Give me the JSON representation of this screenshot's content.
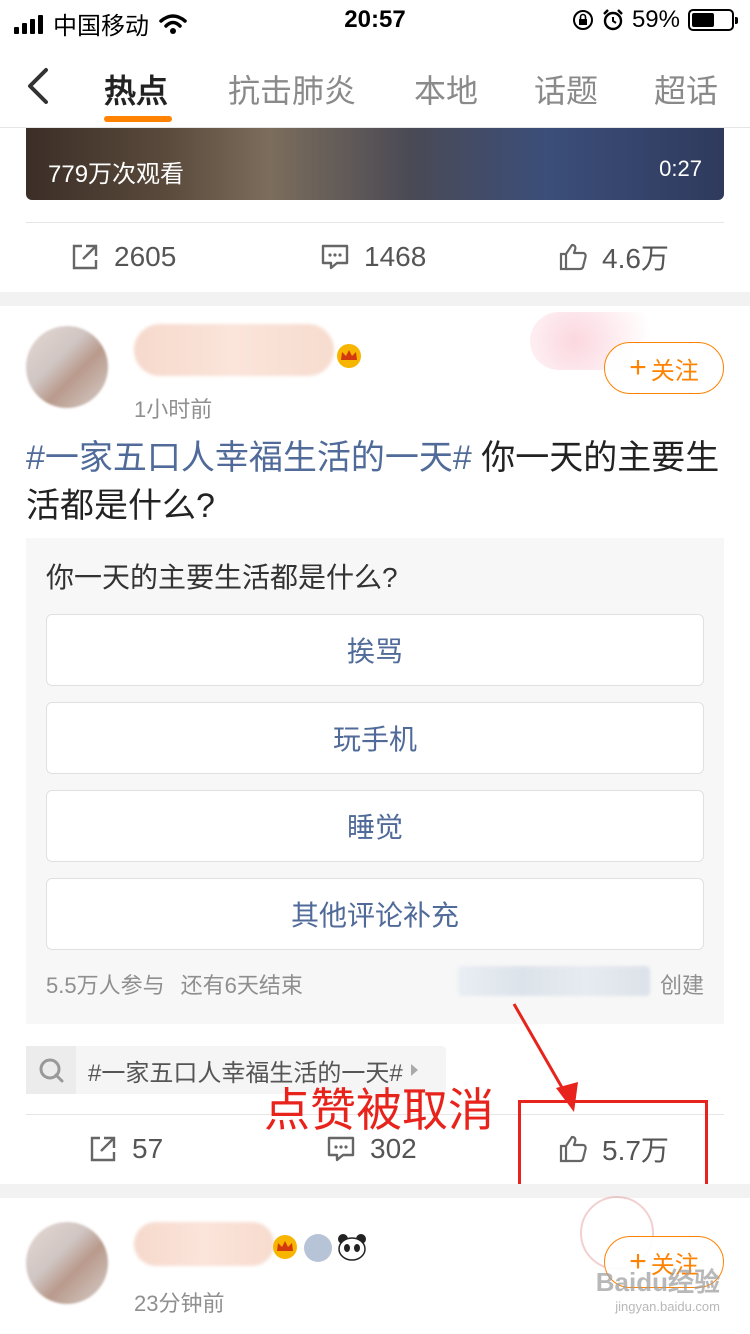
{
  "status_bar": {
    "carrier": "中国移动",
    "time": "20:57",
    "battery": "59%",
    "battery_level": 0.59
  },
  "nav": {
    "tabs": [
      "热点",
      "抗击肺炎",
      "本地",
      "话题",
      "超话"
    ],
    "active_index": 0
  },
  "video_post": {
    "views": "779万次观看",
    "duration": "0:27",
    "repost_count": "2605",
    "comment_count": "1468",
    "like_count": "4.6万"
  },
  "post": {
    "time_ago": "1小时前",
    "follow_label": "关注",
    "topic": "#一家五口人幸福生活的一天#",
    "text": " 你一天的主要生活都是什么?",
    "poll": {
      "question": "你一天的主要生活都是什么?",
      "options": [
        "挨骂",
        "玩手机",
        "睡觉",
        "其他评论补充"
      ],
      "participants": "5.5万人参与",
      "remaining": "还有6天结束",
      "created_suffix": "创建"
    },
    "topic_chip": "#一家五口人幸福生活的一天#",
    "repost_count": "57",
    "comment_count": "302",
    "like_count": "5.7万"
  },
  "annotation": {
    "text": "点赞被取消",
    "color": "#e8231c"
  },
  "next_post": {
    "time_ago": "23分钟前",
    "follow_label": "关注"
  },
  "watermark": {
    "main": "Baidu经验",
    "sub": "jingyan.baidu.com"
  },
  "colors": {
    "accent": "#ff8200",
    "link": "#506b99",
    "annotation": "#e8231c"
  }
}
